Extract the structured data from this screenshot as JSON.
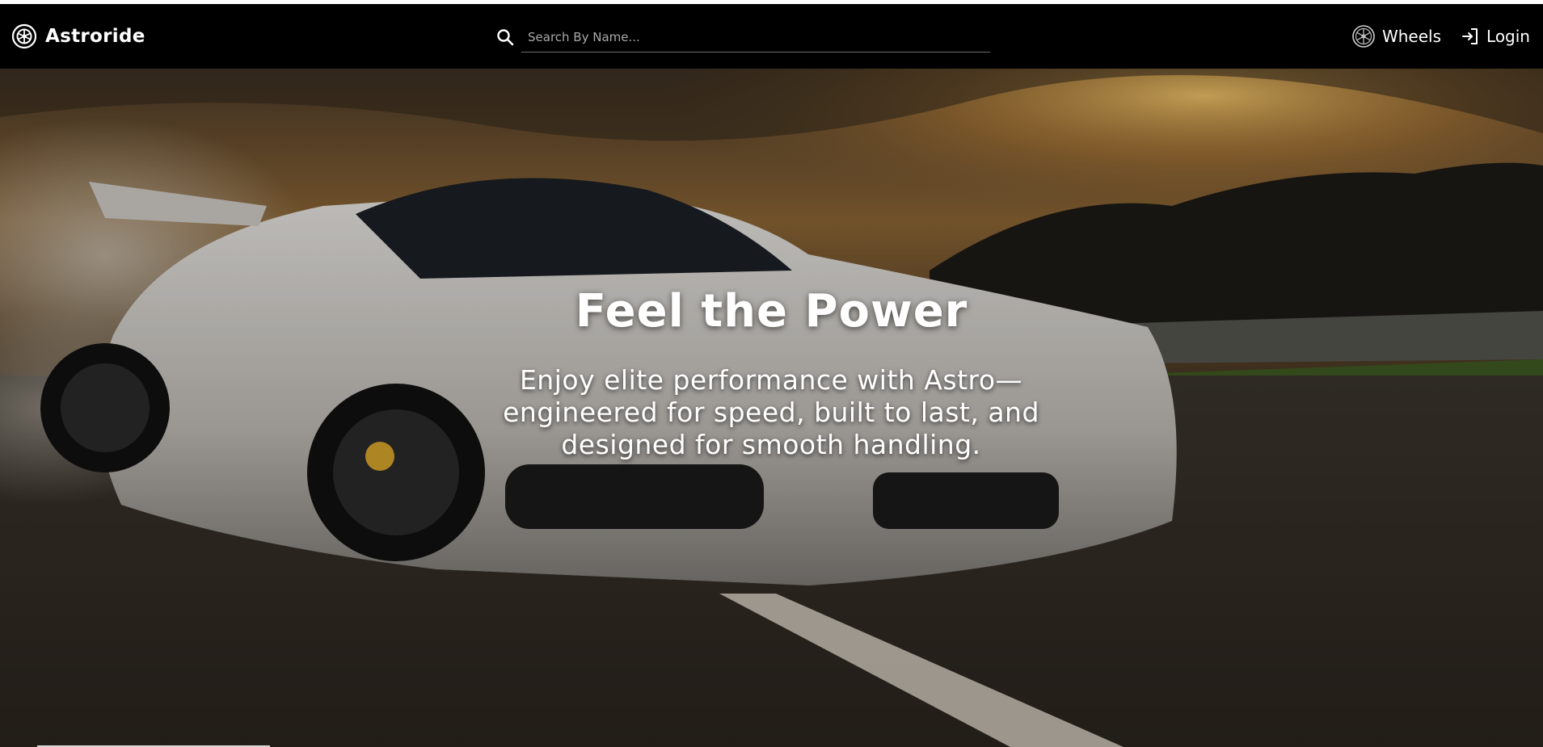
{
  "navbar": {
    "brand_name": "Astroride",
    "search_placeholder": "Search By Name...",
    "links": [
      {
        "label": "Wheels",
        "icon": "wheel-icon"
      },
      {
        "label": "Login",
        "icon": "login-icon"
      }
    ]
  },
  "hero": {
    "title": "Feel the Power",
    "subtitle": "Enjoy elite performance with Astro—engineered for speed, built to last, and designed for smooth handling.",
    "image": "white-sports-car-on-race-track-at-sunset"
  },
  "colors": {
    "navbar_bg": "#000000",
    "text": "#ffffff",
    "search_underline": "#6b6b6b",
    "placeholder": "#a9a9a9"
  }
}
